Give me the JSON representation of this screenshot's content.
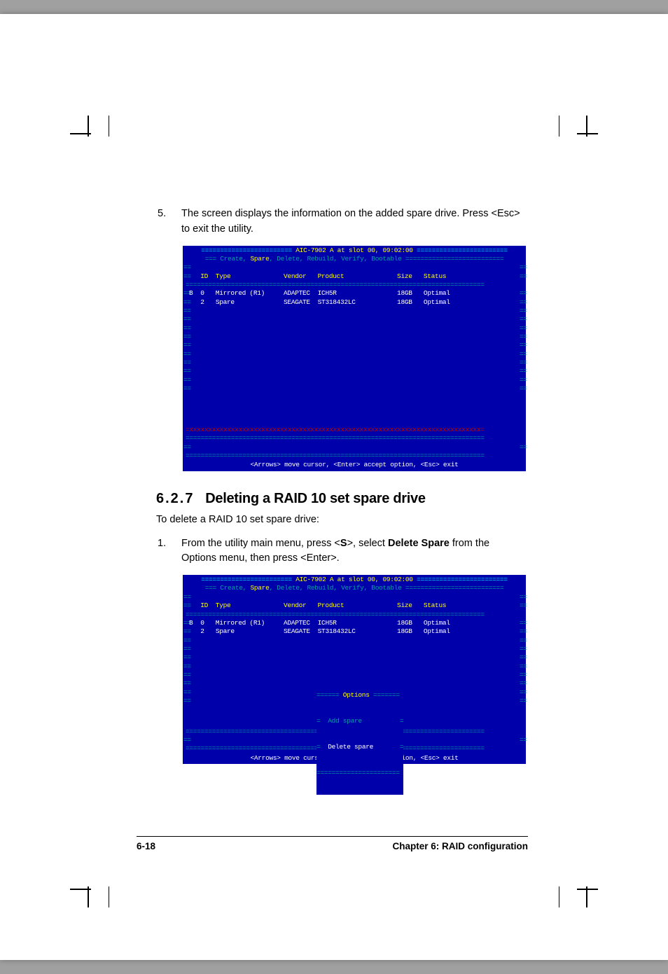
{
  "step5": {
    "num": "5.",
    "text": "The screen displays the information on the added spare drive. Press <Esc> to exit the utility."
  },
  "bios": {
    "title_left_eq": "========================",
    "title_text": " AIC-7902 A at slot 00, 09:02:00 ",
    "title_right_eq": "========================",
    "menu_prefix": "=== ",
    "menu_items": "Create, Spare, Delete, Rebuild, Verify, Bootable",
    "menu_suffix": " ==========================",
    "menu_hl": "Spare",
    "sep": "===============================================================================",
    "cols": "   ID  Type              Vendor   Product              Size   Status",
    "row1": "B  0   Mirrored (R1)     ADAPTEC  ICH5R                18GB   Optimal",
    "row2": "   2   Spare             SEAGATE  ST318432LC           18GB   Optimal",
    "xrow": "=xxxxxxxxxxxxxxxxxxxxxxxxxxxxxxxxxxxxxxxxxxxxxxxxxxxxxxxxxxxxxxxxxxxxxxxxxxxxx=",
    "footer": "<Arrows> move cursor, <Enter> accept option, <Esc> exit"
  },
  "section": {
    "num": "6.2.7",
    "title": "Deleting a RAID 10 set spare drive"
  },
  "intro": "To delete a RAID 10 set spare drive:",
  "step1": {
    "num": "1.",
    "text_a": "From the utility main menu, press <",
    "key": "S",
    "text_b": ">, select ",
    "bold": "Delete Spare",
    "text_c": " from the Options menu, then press <Enter>."
  },
  "popup": {
    "border_top": "====== Options =======",
    "opt1": "  Add spare          ",
    "opt2": "  Delete spare       ",
    "border_bot": "======================"
  },
  "footer": {
    "left": "6-18",
    "right": "Chapter 6: RAID configuration"
  }
}
